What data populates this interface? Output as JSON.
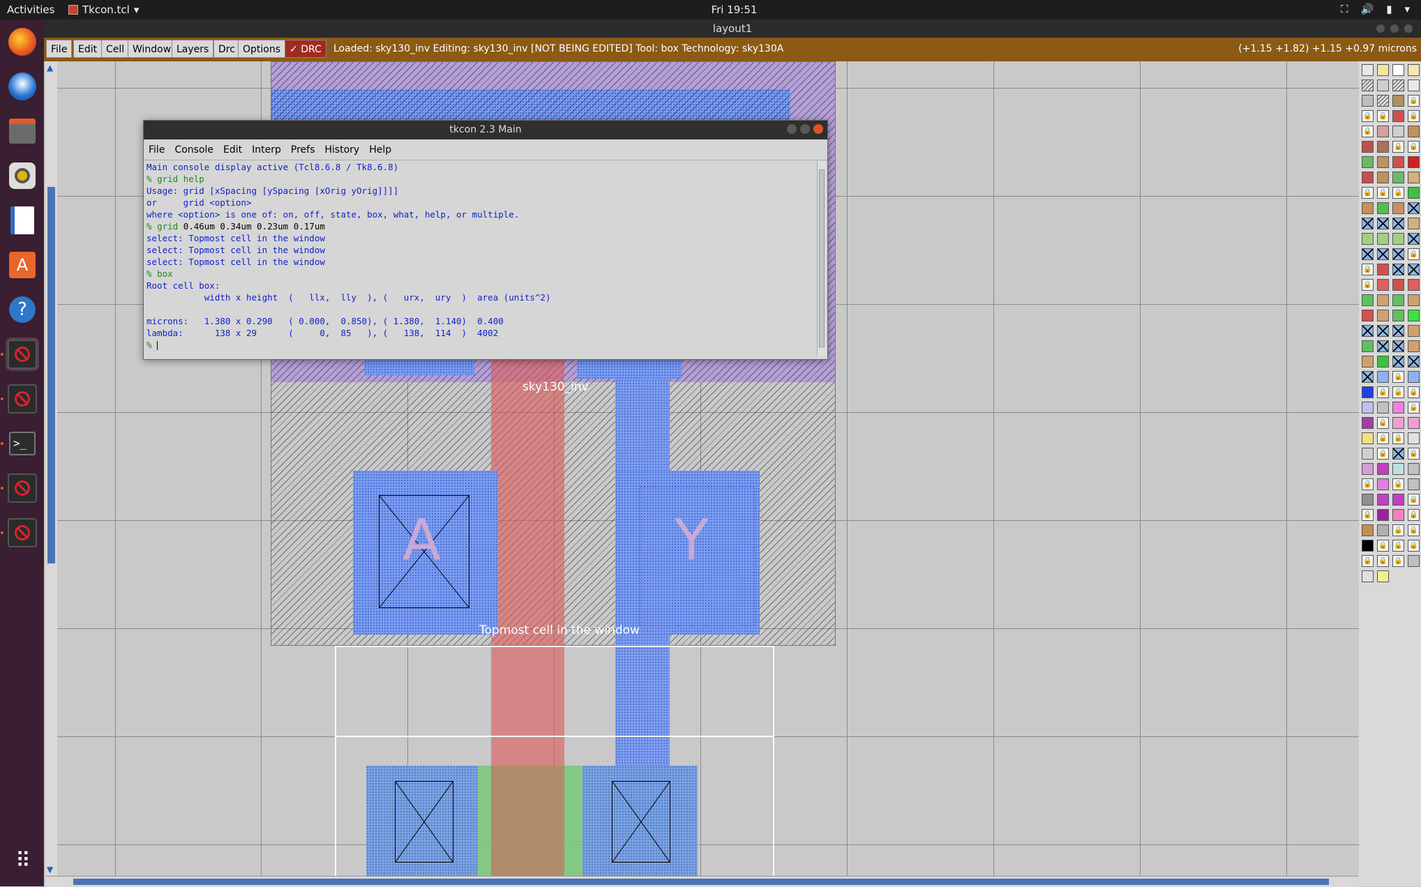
{
  "topbar": {
    "activities": "Activities",
    "app_name": "Tkcon.tcl",
    "clock": "Fri 19:51"
  },
  "dock": {
    "items": [
      "firefox-icon",
      "thunderbird-icon",
      "files-icon",
      "rhythmbox-icon",
      "writer-icon",
      "software-icon",
      "help-icon",
      "magic-icon",
      "magic-icon",
      "terminal-icon",
      "magic-icon",
      "magic-icon"
    ],
    "show_apps": "show-apps-icon"
  },
  "magic": {
    "window_title": "layout1",
    "menu": [
      "File",
      "Edit",
      "Cell",
      "Window",
      "Layers",
      "Drc",
      "Options"
    ],
    "drc_label": "DRC",
    "status": "Loaded: sky130_inv Editing: sky130_inv [NOT BEING EDITED] Tool: box  Technology: sky130A",
    "coords": "(+1.15 +1.82) +1.15 +0.97 microns",
    "labels": {
      "cell_name": "sky130_inv",
      "topmost": "Topmost cell in the window",
      "pin_a": "A",
      "pin_y": "Y"
    }
  },
  "tkcon": {
    "title": "tkcon 2.3 Main",
    "menu": [
      "File",
      "Console",
      "Edit",
      "Interp",
      "Prefs",
      "History",
      "Help"
    ],
    "lines": [
      {
        "type": "out",
        "text": "Main console display active (Tcl8.6.8 / Tk8.6.8)"
      },
      {
        "type": "cmd",
        "prompt": "% ",
        "text": "grid help"
      },
      {
        "type": "out",
        "text": "Usage: grid [xSpacing [ySpacing [xOrig yOrig]]]]"
      },
      {
        "type": "out",
        "text": "or     grid <option>"
      },
      {
        "type": "out",
        "text": "where <option> is one of: on, off, state, box, what, help, or multiple."
      },
      {
        "type": "cmd2",
        "prompt": "% ",
        "kw": "grid",
        "text": " 0.46um 0.34um 0.23um 0.17um"
      },
      {
        "type": "out",
        "text": "select: Topmost cell in the window"
      },
      {
        "type": "out",
        "text": "select: Topmost cell in the window"
      },
      {
        "type": "out",
        "text": "select: Topmost cell in the window"
      },
      {
        "type": "cmd",
        "prompt": "% ",
        "text": "box"
      },
      {
        "type": "out",
        "text": "Root cell box:"
      },
      {
        "type": "out",
        "text": "           width x height  (   llx,  lly  ), (   urx,  ury  )  area (units^2)"
      },
      {
        "type": "out",
        "text": ""
      },
      {
        "type": "out",
        "text": "microns:   1.380 x 0.290   ( 0.000,  0.850), ( 1.380,  1.140)  0.400"
      },
      {
        "type": "out",
        "text": "lambda:      138 x 29      (     0,  85   ), (   138,  114  )  4002"
      },
      {
        "type": "cmd",
        "prompt": "% ",
        "text": ""
      }
    ]
  }
}
